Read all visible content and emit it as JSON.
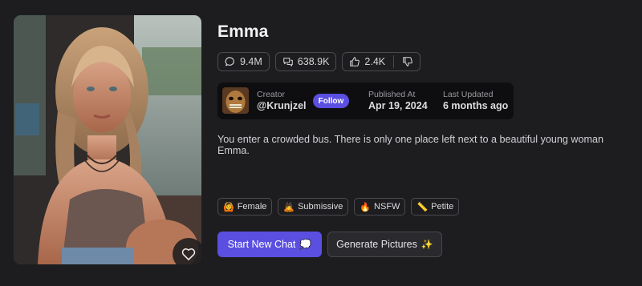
{
  "character": {
    "name": "Emma",
    "description": "You enter a crowded bus. There is only one place left next to a beautiful young woman Emma."
  },
  "stats": {
    "views": "9.4M",
    "messages": "638.9K",
    "likes": "2.4K"
  },
  "creator": {
    "label": "Creator",
    "handle": "@Krunjzel",
    "follow_label": "Follow",
    "published_label": "Published At",
    "published_value": "Apr 19, 2024",
    "updated_label": "Last Updated",
    "updated_value": "6 months ago"
  },
  "tags": [
    {
      "emoji": "🙆",
      "label": "Female"
    },
    {
      "emoji": "🙇",
      "label": "Submissive"
    },
    {
      "emoji": "🔥",
      "label": "NSFW"
    },
    {
      "emoji": "📏",
      "label": "Petite"
    }
  ],
  "actions": {
    "start_chat_label": "Start New Chat",
    "start_chat_emoji": "💭",
    "generate_label": "Generate Pictures",
    "generate_emoji": "✨"
  },
  "icons": {
    "views": "chat-bubble-icon",
    "messages": "messages-icon",
    "like": "thumbs-up-icon",
    "dislike": "thumbs-down-icon",
    "favorite": "heart-icon"
  },
  "colors": {
    "background": "#1d1d20",
    "accent": "#5a4fe0",
    "creator_box": "#0e0e10"
  }
}
